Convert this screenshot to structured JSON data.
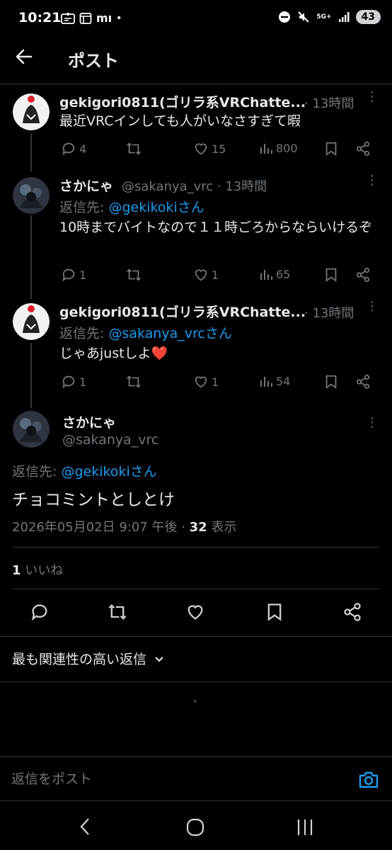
{
  "status_bar": {
    "time": "10:21",
    "mi": "mı",
    "dot": "•",
    "net": "5G+",
    "battery": "43"
  },
  "header": {
    "title": "ポスト"
  },
  "thread": [
    {
      "name": "gekigori0811(ゴリラ系VRChatte...",
      "meta": "· 13時間",
      "text": "最近VRCインしても人がいなさすぎて暇",
      "reply_to_prefix": "",
      "reply_to_user": "",
      "stats": {
        "replies": "4",
        "reposts": "",
        "likes": "15",
        "views": "800"
      }
    },
    {
      "name": "さかにゃ",
      "meta": "@sakanya_vrc · 13時間",
      "text": "10時までバイトなので１１時ごろからならいけるぞ",
      "reply_to_prefix": "返信先: ",
      "reply_to_user": "@gekikokiさん",
      "stats": {
        "replies": "1",
        "reposts": "",
        "likes": "1",
        "views": "65"
      }
    },
    {
      "name": "gekigori0811(ゴリラ系VRChatte...",
      "meta": "· 13時間",
      "text": "じゃあjustしよ",
      "emoji": "❤️",
      "reply_to_prefix": "返信先: ",
      "reply_to_user": "@sakanya_vrcさん",
      "stats": {
        "replies": "1",
        "reposts": "",
        "likes": "1",
        "views": "54"
      }
    }
  ],
  "main_post": {
    "name": "さかにゃ",
    "handle": "@sakanya_vrc",
    "reply_to_prefix": "返信先: ",
    "reply_to_user": "@gekikokiさん",
    "text": "チョコミントとしとけ",
    "timestamp": "2026年05月02日 9:07 午後 · ",
    "views_count": "32",
    "views_label": " 表示",
    "likes_count": "1",
    "likes_label": " いいね"
  },
  "sort": {
    "label": "最も関連性の高い返信"
  },
  "composer": {
    "placeholder": "返信をポスト"
  },
  "colors": {
    "accent": "#1d9bf0",
    "muted": "#71767b",
    "background": "#000000",
    "heart": "#f91880"
  }
}
